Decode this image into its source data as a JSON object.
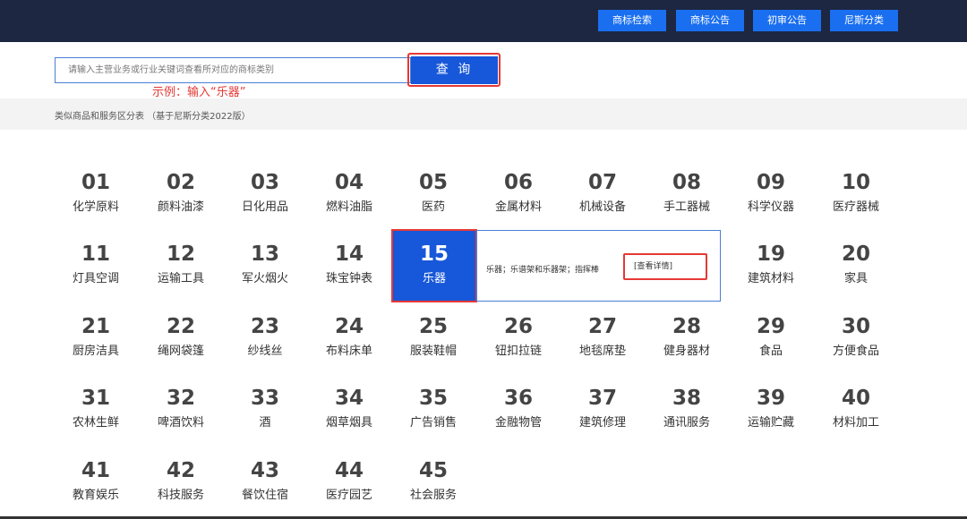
{
  "nav": {
    "items": [
      "商标检索",
      "商标公告",
      "初审公告",
      "尼斯分类"
    ]
  },
  "search": {
    "placeholder": "请输入主营业务或行业关键词查看所对应的商标类别",
    "button_label": "查 询",
    "example_note": "示例：输入“乐器”"
  },
  "subtitle": "类似商品和服务区分表 （基于尼斯分类2022版）",
  "classes": [
    {
      "num": "01",
      "name": "化学原料"
    },
    {
      "num": "02",
      "name": "颜料油漆"
    },
    {
      "num": "03",
      "name": "日化用品"
    },
    {
      "num": "04",
      "name": "燃料油脂"
    },
    {
      "num": "05",
      "name": "医药"
    },
    {
      "num": "06",
      "name": "金属材料"
    },
    {
      "num": "07",
      "name": "机械设备"
    },
    {
      "num": "08",
      "name": "手工器械"
    },
    {
      "num": "09",
      "name": "科学仪器"
    },
    {
      "num": "10",
      "name": "医疗器械"
    },
    {
      "num": "11",
      "name": "灯具空调"
    },
    {
      "num": "12",
      "name": "运输工具"
    },
    {
      "num": "13",
      "name": "军火烟火"
    },
    {
      "num": "14",
      "name": "珠宝钟表"
    },
    {
      "num": "15",
      "name": "乐器"
    },
    {
      "num": "19",
      "name": "建筑材料"
    },
    {
      "num": "20",
      "name": "家具"
    },
    {
      "num": "21",
      "name": "厨房洁具"
    },
    {
      "num": "22",
      "name": "绳网袋篷"
    },
    {
      "num": "23",
      "name": "纱线丝"
    },
    {
      "num": "24",
      "name": "布料床单"
    },
    {
      "num": "25",
      "name": "服装鞋帽"
    },
    {
      "num": "26",
      "name": "钮扣拉链"
    },
    {
      "num": "27",
      "name": "地毯席垫"
    },
    {
      "num": "28",
      "name": "健身器材"
    },
    {
      "num": "29",
      "name": "食品"
    },
    {
      "num": "30",
      "name": "方便食品"
    },
    {
      "num": "31",
      "name": "农林生鲜"
    },
    {
      "num": "32",
      "name": "啤酒饮料"
    },
    {
      "num": "33",
      "name": "酒"
    },
    {
      "num": "34",
      "name": "烟草烟具"
    },
    {
      "num": "35",
      "name": "广告销售"
    },
    {
      "num": "36",
      "name": "金融物管"
    },
    {
      "num": "37",
      "name": "建筑修理"
    },
    {
      "num": "38",
      "name": "通讯服务"
    },
    {
      "num": "39",
      "name": "运输贮藏"
    },
    {
      "num": "40",
      "name": "材料加工"
    },
    {
      "num": "41",
      "name": "教育娱乐"
    },
    {
      "num": "42",
      "name": "科技服务"
    },
    {
      "num": "43",
      "name": "餐饮住宿"
    },
    {
      "num": "44",
      "name": "医疗园艺"
    },
    {
      "num": "45",
      "name": "社会服务"
    }
  ],
  "detail": {
    "text": "乐器；乐谱架和乐器架；指挥棒",
    "link_label": "[查看详情]"
  },
  "colors": {
    "topbar": "#1d2742",
    "accent": "#1757d9",
    "highlight": "#e53935"
  }
}
